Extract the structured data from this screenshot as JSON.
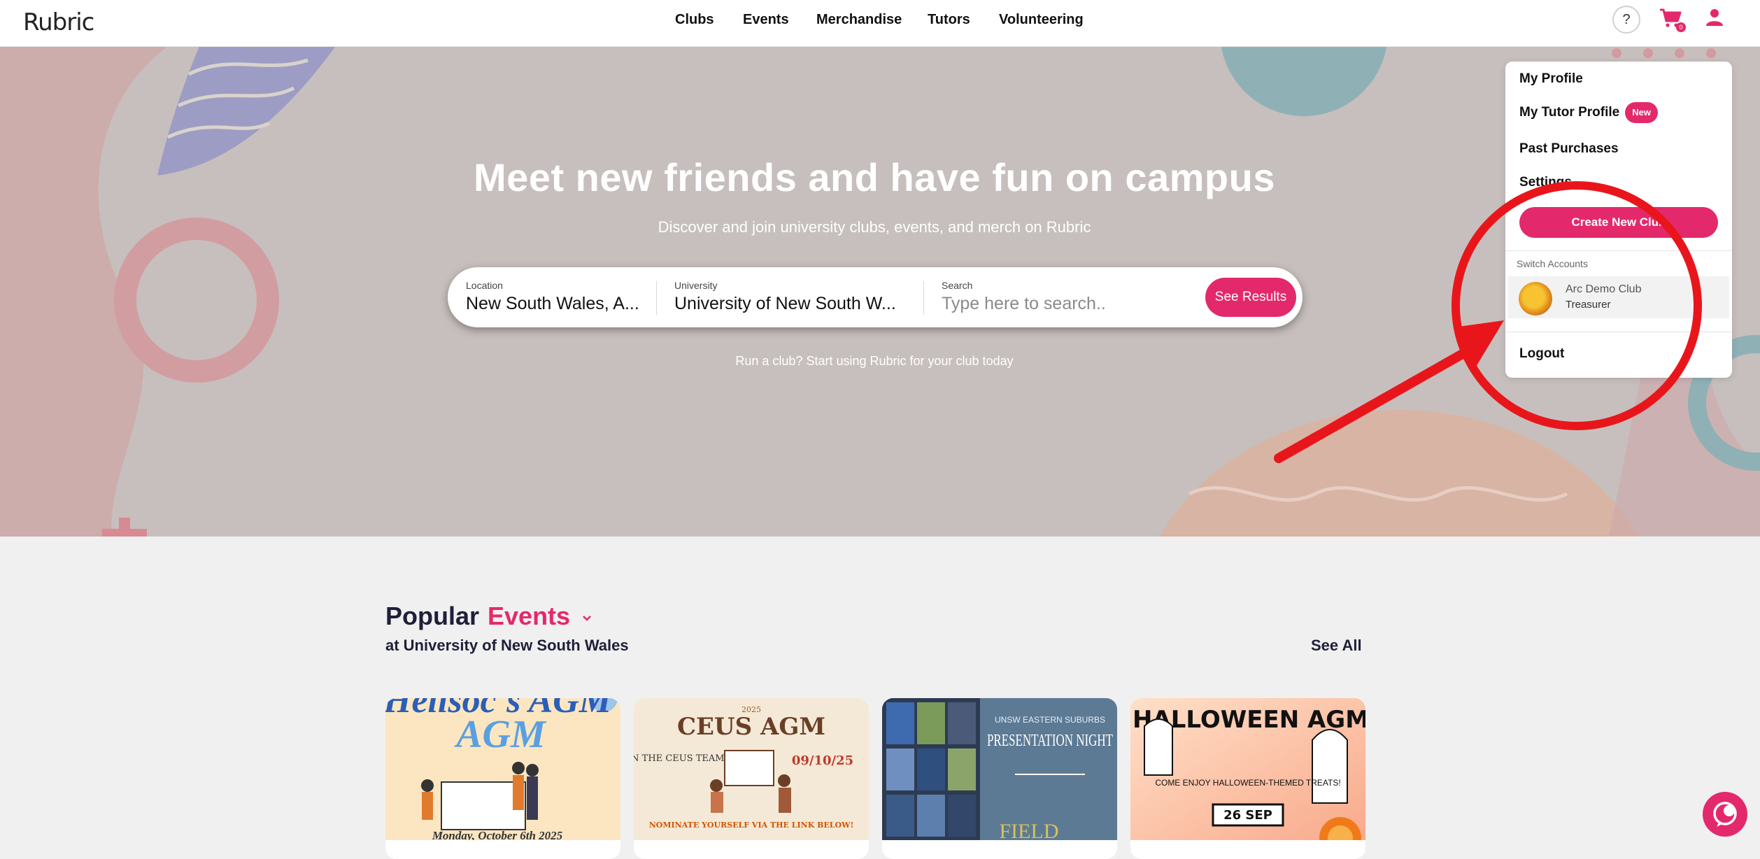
{
  "nav": {
    "logo": "Rubric",
    "links": [
      "Clubs",
      "Events",
      "Merchandise",
      "Tutors",
      "Volunteering"
    ],
    "help_label": "?",
    "cart_count": "0"
  },
  "hero": {
    "title": "Meet new friends and have fun on campus",
    "subtitle": "Discover and join university clubs, events, and merch on Rubric",
    "search": {
      "location_label": "Location",
      "location_value": "New South Wales, A...",
      "university_label": "University",
      "university_value": "University of New South W...",
      "search_label": "Search",
      "search_placeholder": "Type here to search..",
      "button": "See Results"
    },
    "run_club": "Run a club? Start using Rubric for your club today"
  },
  "popular": {
    "title": "Popular",
    "category": "Events",
    "subtitle": "at University of New South Wales",
    "see_all": "See All",
    "cards": [
      {
        "text": "Hellsoc's AGM",
        "footer": "Monday, October 6th 2025"
      },
      {
        "text": "CEUS AGM",
        "year": "2025",
        "join": "JOIN THE CEUS TEAM!",
        "date": "09/10/25",
        "nominate": "NOMINATE YOURSELF VIA THE LINK BELOW!"
      },
      {
        "text": "PRESENTATION NIGHT",
        "org": "UNSW EASTERN SUBURBS",
        "field": "FIELD"
      },
      {
        "text": "HALLOWEEN AGM",
        "line": "COME ENJOY HALLOWEEN-THEMED TREATS!",
        "date": "26 SEP"
      }
    ]
  },
  "dropdown": {
    "my_profile": "My Profile",
    "my_tutor_profile": "My Tutor Profile",
    "new_badge": "New",
    "past_purchases": "Past Purchases",
    "settings": "Settings",
    "create_club": "Create New Club",
    "switch_accounts": "Switch Accounts",
    "account_name": "Arc Demo Club",
    "account_role": "Treasurer",
    "logout": "Logout"
  },
  "colors": {
    "accent": "#e3296b",
    "hero_bg": "#c7bfbd",
    "annotation": "#e8161b",
    "heading": "#1f1f3a"
  },
  "icons": [
    "help-icon",
    "cart-icon",
    "user-icon",
    "chevron-down-icon",
    "chat-icon"
  ]
}
